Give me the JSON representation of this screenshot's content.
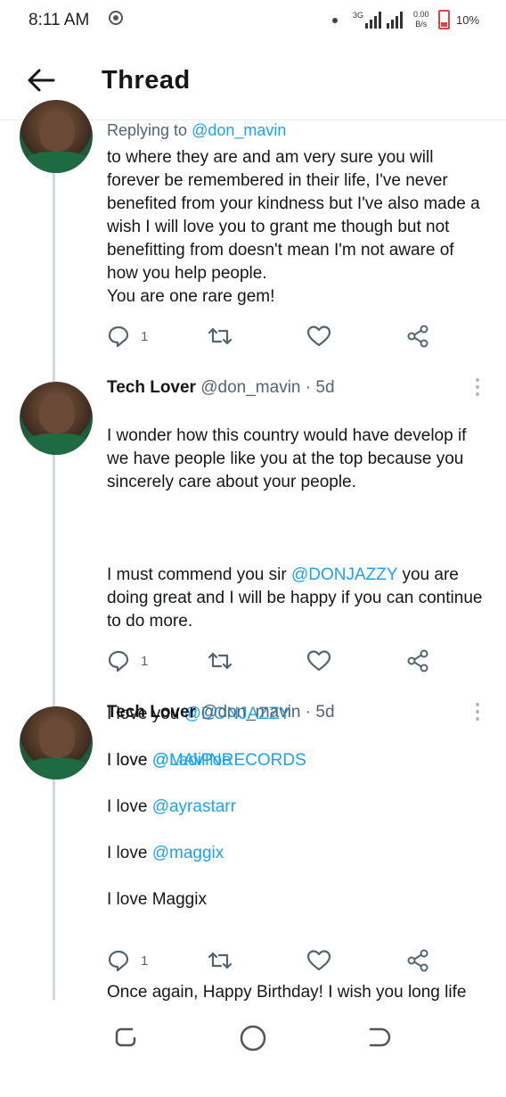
{
  "status_bar": {
    "time": "8:11 AM",
    "network": "3G",
    "speed_top": "0.00",
    "speed_bottom": "B/s",
    "battery": "10%"
  },
  "header": {
    "title": "Thread"
  },
  "replying": {
    "prefix": "Replying to ",
    "handle": "@don_mavin"
  },
  "tweets": [
    {
      "text": "to where they are and am very sure you will forever be remembered in their life, I've never benefited from your kindness but I've also made a wish I will love you to grant me though but not benefitting from doesn't mean I'm not aware of how you help people.\nYou are one rare gem!",
      "reply_count": "1"
    },
    {
      "name": "Tech Lover",
      "handle": "@don_mavin",
      "time": "· 5d",
      "p1": "I wonder how this country would have develop if we have people like you at the top because you sincerely care about your people.",
      "p2_a": "I must commend you sir ",
      "p2_m": "@DONJAZZY",
      "p2_b": " you are doing great and I will be happy if you can continue to do more.",
      "l1_a": "I love you ",
      "l1_m": "@DONJAZZY",
      "l2_a": "I love ",
      "l2_m": "@MAVINRECORDS",
      "reply_count": "1"
    },
    {
      "name": "Tech Lover",
      "handle": "@don_mavin",
      "time": "· 5d",
      "l1_a": "I love ",
      "l1_m": "@LadiPoe",
      "l2_a": "I love ",
      "l2_m": "@ayrastarr",
      "l3_a": "I love ",
      "l3_m": "@maggix",
      "l4": "I love Maggix",
      "p2": "Once again, Happy Birthday! I wish you long life and prosperity and I wish you all the greatest thing you want in life, may you never lack, you shall forever be blessed.",
      "reply_count": "1"
    }
  ],
  "colors": {
    "mention": "#1da1f2",
    "text": "#14171a",
    "secondary": "#536471",
    "icon": "#536471"
  }
}
